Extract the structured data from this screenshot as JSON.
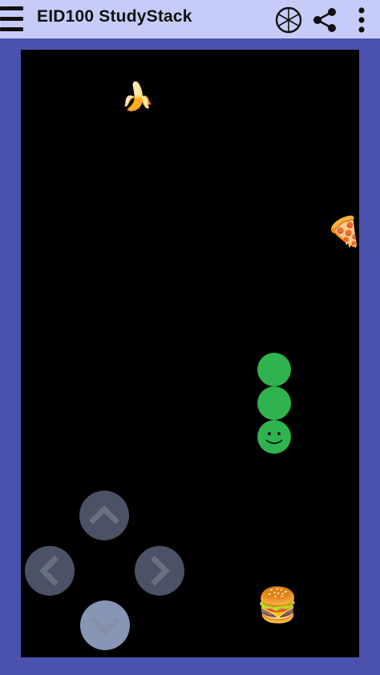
{
  "toolbar": {
    "title": "EID100 StudyStack",
    "menu_icon": "hamburger-menu-icon",
    "actions": [
      {
        "name": "crosshair-wheel-icon"
      },
      {
        "name": "share-icon"
      },
      {
        "name": "overflow-menu-icon"
      }
    ]
  },
  "game": {
    "type": "snake",
    "board_color": "#000000",
    "frame_color": "#4a52ae",
    "snake_color": "#2eb34e",
    "snake_length": 3,
    "snake_direction": "down",
    "food": [
      {
        "kind": "banana",
        "glyph": "🍌"
      },
      {
        "kind": "pizza",
        "glyph": "🍕"
      },
      {
        "kind": "burger",
        "glyph": "🍔"
      }
    ]
  },
  "controls": {
    "buttons": [
      "up",
      "left",
      "right",
      "down"
    ],
    "active": "down"
  }
}
